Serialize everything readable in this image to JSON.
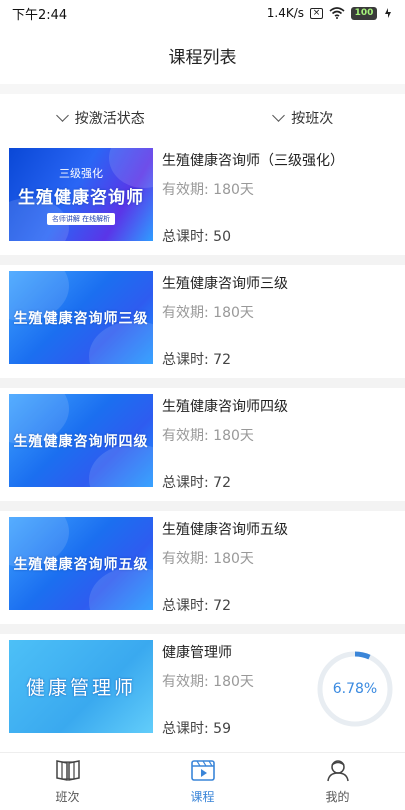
{
  "status_bar": {
    "time": "下午2:44",
    "speed": "1.4K/s",
    "battery": "100"
  },
  "header": {
    "title": "课程列表"
  },
  "filters": [
    {
      "label": "按激活状态"
    },
    {
      "label": "按班次"
    }
  ],
  "courses": [
    {
      "title": "生殖健康咨询师（三级强化）",
      "validity": "有效期:  180天",
      "hours": "总课时:  50",
      "thumb": {
        "line1": "三级强化",
        "line2": "生殖健康咨询师",
        "tag": "名师讲解   在线解析"
      }
    },
    {
      "title": "生殖健康咨询师三级",
      "validity": "有效期:  180天",
      "hours": "总课时:  72",
      "thumb": {
        "line2": "生殖健康咨询师三级"
      }
    },
    {
      "title": "生殖健康咨询师四级",
      "validity": "有效期:  180天",
      "hours": "总课时:  72",
      "thumb": {
        "line2": "生殖健康咨询师四级"
      }
    },
    {
      "title": "生殖健康咨询师五级",
      "validity": "有效期:  180天",
      "hours": "总课时:  72",
      "thumb": {
        "line2": "生殖健康咨询师五级"
      }
    },
    {
      "title": "健康管理师",
      "validity": "有效期:  180天",
      "hours": "总课时:  59",
      "thumb": {
        "line2": "健康管理师"
      }
    }
  ],
  "progress": {
    "label": "6.78%",
    "value": 0.0678
  },
  "tabbar": {
    "tabs": [
      {
        "label": "班次",
        "icon": "book-icon"
      },
      {
        "label": "课程",
        "icon": "video-icon"
      },
      {
        "label": "我的",
        "icon": "user-icon"
      }
    ],
    "active_index": 1
  },
  "colors": {
    "accent": "#3a85d8",
    "progress_track": "#e8edf2"
  }
}
